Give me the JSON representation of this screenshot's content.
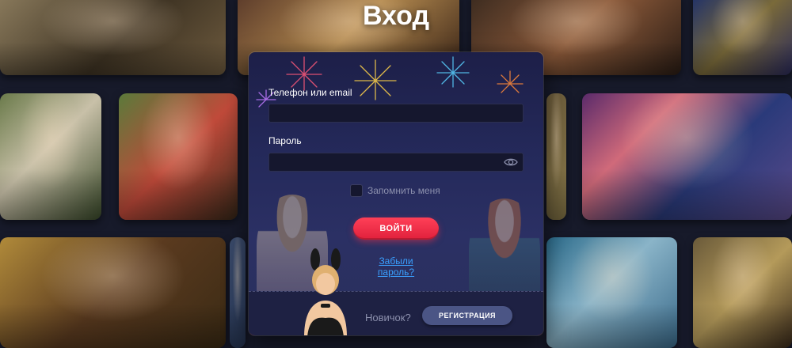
{
  "page": {
    "title": "Вход"
  },
  "login_form": {
    "login_label": "Телефон или email",
    "login_value": "",
    "password_label": "Пароль",
    "password_value": "",
    "password_visibility_icon": "eye-icon",
    "remember_label": "Запомнить меня",
    "remember_checked": false,
    "submit_label": "ВОЙТИ",
    "forgot_password_label": "Забыли пароль?",
    "newbie_label": "Новичок?",
    "register_label": "РЕГИСТРАЦИЯ"
  },
  "colors": {
    "accent": "#e8304a",
    "link": "#3aa0ff",
    "modal_bg": "#24295a",
    "register_button": "#4b5585",
    "page_bg": "#171a2a"
  }
}
